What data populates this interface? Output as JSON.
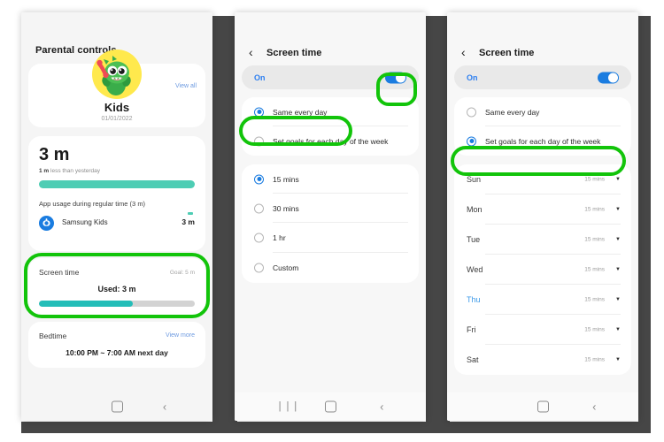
{
  "phone1": {
    "header": "Parental controls",
    "profile": {
      "name": "Kids",
      "date": "01/01/2022",
      "view_all": "View all",
      "avatar_icon": "kids-dinosaur-avatar"
    },
    "usage": {
      "total": "3 m",
      "compare_bold": "1 m",
      "compare_rest": " less than yesterday",
      "section_label": "App usage during regular time (3 m)",
      "app_name": "Samsung Kids",
      "app_icon": "samsung-kids-app-icon",
      "app_time": "3 m",
      "bar_percent": 100
    },
    "screen_time": {
      "label": "Screen time",
      "goal": "Goal: 5 m",
      "used": "Used: 3 m",
      "progress_percent": 60
    },
    "bedtime": {
      "label": "Bedtime",
      "view_more": "View more",
      "value": "10:00 PM ~ 7:00 AM next day"
    },
    "navbar": {
      "home": "home-icon",
      "back": "back-icon"
    }
  },
  "phone2": {
    "title": "Screen time",
    "back_icon": "back-chevron-icon",
    "toggle": {
      "label": "On",
      "state": "on"
    },
    "mode_options": [
      {
        "label": "Same every day",
        "selected": true
      },
      {
        "label": "Set goals for each day of the week",
        "selected": false
      }
    ],
    "duration_options": [
      {
        "label": "15 mins",
        "selected": true
      },
      {
        "label": "30 mins",
        "selected": false
      },
      {
        "label": "1 hr",
        "selected": false
      },
      {
        "label": "Custom",
        "selected": false
      }
    ],
    "navbar": {
      "recents": "|||",
      "home": "home-icon",
      "back": "back-icon"
    }
  },
  "phone3": {
    "title": "Screen time",
    "back_icon": "back-chevron-icon",
    "toggle": {
      "label": "On",
      "state": "on"
    },
    "mode_options": [
      {
        "label": "Same every day",
        "selected": false
      },
      {
        "label": "Set goals for each day of the week",
        "selected": true
      }
    ],
    "days": [
      {
        "day": "Sun",
        "value": "15 mins",
        "highlighted": false
      },
      {
        "day": "Mon",
        "value": "15 mins",
        "highlighted": false
      },
      {
        "day": "Tue",
        "value": "15 mins",
        "highlighted": false
      },
      {
        "day": "Wed",
        "value": "15 mins",
        "highlighted": false
      },
      {
        "day": "Thu",
        "value": "15 mins",
        "highlighted": true
      },
      {
        "day": "Fri",
        "value": "15 mins",
        "highlighted": false
      },
      {
        "day": "Sat",
        "value": "15 mins",
        "highlighted": false
      }
    ],
    "navbar": {
      "home": "home-icon",
      "back": "back-icon"
    }
  },
  "annotations": {
    "color": "#12c40a",
    "items": [
      "screen-time-card-highlight",
      "screen-time-toggle-highlight",
      "same-every-day-highlight",
      "set-goals-each-day-highlight"
    ]
  },
  "colors": {
    "accent_blue": "#1a7ce0",
    "link_blue": "#6d9ae0",
    "teal_bar": "#4ecdb4",
    "progress_teal": "#23bdb8",
    "annotation_green": "#12c40a",
    "bezel": "#464646"
  }
}
